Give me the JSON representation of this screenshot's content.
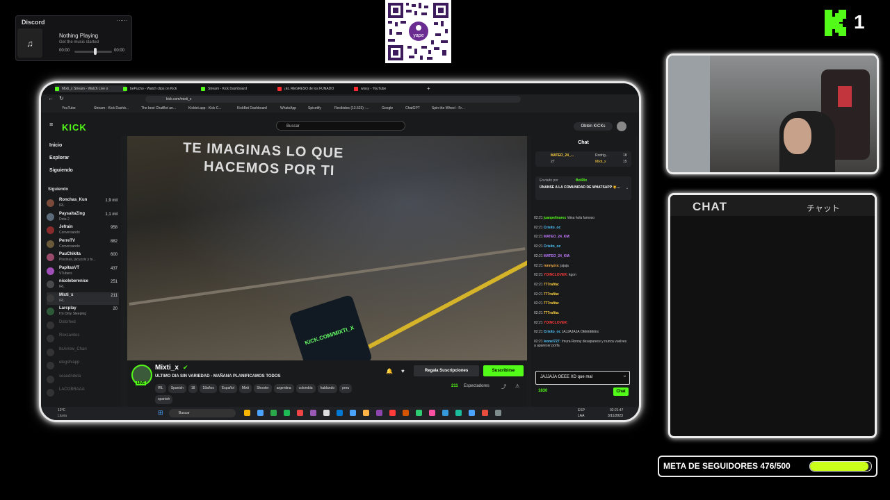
{
  "discord": {
    "title": "Discord",
    "now_playing": "Nothing Playing",
    "subtitle": "Get the music started",
    "time_start": "00:00",
    "time_end": "00:00"
  },
  "brand": {
    "kick_rank": "1"
  },
  "browser": {
    "tabs": [
      "Mixti_x Stream - Watch Live o",
      "bePucho - Watch clips on Kick",
      "Stream - Kick Dashboard",
      "¡EL REGRESO de los FUNADO",
      "wissy - YouTube"
    ],
    "url": "kick.com/mixti_x",
    "bookmarks": [
      "YouTube",
      "Stream - Kick Dashb...",
      "The best ChatBot an...",
      "Kicklet.app - Kick C...",
      "KickBot Dashboard",
      "WhatsApp",
      "Spicetify",
      "Recibidos (13.523) -...",
      "Google",
      "ChatGPT",
      "Spin the Wheel - Fr..."
    ]
  },
  "kick": {
    "search_placeholder": "Buscar",
    "get_kicks": "Obtén KICKs",
    "nav": [
      "Inicio",
      "Explorar",
      "Siguiendo"
    ],
    "following_label": "Siguiendo",
    "following": [
      {
        "name": "Ronchas_Kun",
        "category": "IRL",
        "viewers": "1,9 mil",
        "online": true
      },
      {
        "name": "PaysaitaZing",
        "category": "Dota 2",
        "viewers": "1,1 mil",
        "online": true
      },
      {
        "name": "Jefrain",
        "category": "Conversando",
        "viewers": "958",
        "online": true
      },
      {
        "name": "PerreTV",
        "category": "Conversando",
        "viewers": "882",
        "online": true
      },
      {
        "name": "PauChikita",
        "category": "Piscinas, jacuzzis y bi...",
        "viewers": "600",
        "online": true
      },
      {
        "name": "PapitasVT",
        "category": "VTubers",
        "viewers": "437",
        "online": true
      },
      {
        "name": "nicoleberenice",
        "category": "IRL",
        "viewers": "251",
        "online": true
      },
      {
        "name": "Mixti_x",
        "category": "IRL",
        "viewers": "211",
        "online": true
      },
      {
        "name": "Larcplay",
        "category": "I'm Only Sleeping",
        "viewers": "20",
        "online": true
      },
      {
        "name": "Dslcrhed",
        "category": "",
        "viewers": "",
        "online": false
      },
      {
        "name": "Roxcavitos",
        "category": "",
        "viewers": "",
        "online": false
      },
      {
        "name": "ItsArrow_Chan",
        "category": "",
        "viewers": "",
        "online": false
      },
      {
        "name": "elegofvapp",
        "category": "",
        "viewers": "",
        "online": false
      },
      {
        "name": "seaudndela",
        "category": "",
        "viewers": "",
        "online": false
      },
      {
        "name": "LACOBRAAA",
        "category": "",
        "viewers": "",
        "online": false
      }
    ],
    "video_text": [
      "TE IMAGINAS LO QUE",
      "HACEMOS POR TI"
    ],
    "phone_text": "KICK.COM/MIXTI_X",
    "streamer": "Mixti_x",
    "live_badge": "LIVE",
    "stream_title": "ULTIMO DIA SIN VARIEDAD - MAÑANA PLANIFICAMOS TODOS",
    "tags": [
      "IRL",
      "Spanish",
      "18",
      "18años",
      "Español",
      "Mixti",
      "Shooter",
      "argentina",
      "colombia",
      "hablando",
      "peru",
      "spanish"
    ],
    "gift_btn": "Regala Suscripciones",
    "sub_btn": "Suscribirse",
    "viewers": "211",
    "viewers_label": "Espectadores"
  },
  "chat": {
    "title": "Chat",
    "top_gifters": [
      {
        "name": "MATEO_24_...",
        "count": "27"
      },
      {
        "name": "Rodrig...",
        "count": "18"
      },
      {
        "name": "Mixti_x",
        "count": "15"
      }
    ],
    "pinned_by": "Enviado por",
    "pinned_bot": "BotRix",
    "pinned_text": "ÚNANSE A LA COMUNIDAD DE WHATSAPP ☀️...",
    "messages": [
      {
        "time": "02:21",
        "user": "juanpelinarex",
        "text": "!dina hola famoso",
        "color": "#53fc18"
      },
      {
        "time": "02:21",
        "user": "Crisito_oc",
        "text": "",
        "color": "#53c8ff"
      },
      {
        "time": "02:21",
        "user": "MATEO_24_KM:",
        "text": "",
        "color": "#c178ff"
      },
      {
        "time": "02:21",
        "user": "Crisito_oc",
        "text": "",
        "color": "#53c8ff"
      },
      {
        "time": "02:21",
        "user": "MATEO_24_KM:",
        "text": "",
        "color": "#c178ff"
      },
      {
        "time": "02:21",
        "user": "ronnyzrs:",
        "text": "jajaja",
        "color": "#ffb347"
      },
      {
        "time": "02:21",
        "user": "YOINCLOVER:",
        "text": "kgon",
        "color": "#ff3b3b"
      },
      {
        "time": "02:21",
        "user": "777rafita:",
        "text": "",
        "color": "#ffd23f"
      },
      {
        "time": "02:21",
        "user": "777rafita:",
        "text": "",
        "color": "#ffd23f"
      },
      {
        "time": "02:21",
        "user": "777rafita:",
        "text": "",
        "color": "#ffd23f"
      },
      {
        "time": "02:21",
        "user": "777rafita:",
        "text": "",
        "color": "#ffd23f"
      },
      {
        "time": "02:21",
        "user": "YOINCLOVER:",
        "text": "",
        "color": "#ff3b3b"
      },
      {
        "time": "02:21",
        "user": "Crisito_oc",
        "text": "JAJJAJAJA OEEEEEEx",
        "color": "#53c8ff"
      },
      {
        "time": "02:21",
        "user": "leonel727:",
        "text": "!mura Ronny desaparece y nunca vuelves a aparecer porfa",
        "color": "#53c8ff"
      }
    ],
    "input_value": "JAJJAJA OEEE XD que mal",
    "points": "1830",
    "send": "Chat"
  },
  "taskbar": {
    "weather_temp": "12°C",
    "weather_desc": "Lluvia",
    "search": "Buscar",
    "lang": "ESP",
    "lang2": "LAA",
    "time": "02:21:47",
    "date": "3/11/2023"
  },
  "overlay_chat": {
    "title": "CHAT",
    "title_jp": "チャット"
  },
  "goal": {
    "label": "META DE SEGUIDORES 476/500",
    "current": 476,
    "target": 500
  },
  "colors": {
    "kick_green": "#53fc18",
    "goal_fill": "#c9ff1a"
  }
}
